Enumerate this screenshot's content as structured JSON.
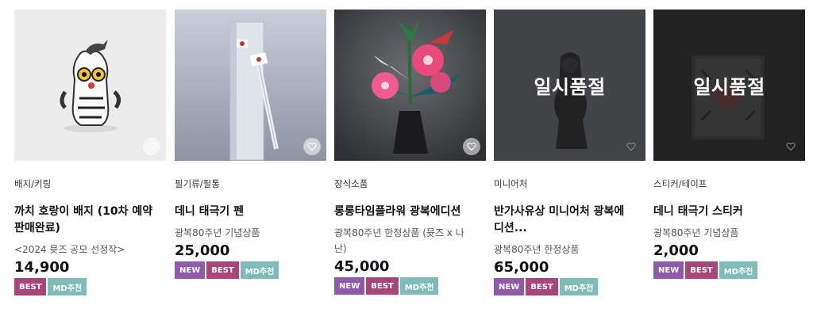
{
  "products": [
    {
      "category": "배지/키링",
      "name_lines": [
        "까치 호랑이 배지 (10차 예약",
        "판매완료)"
      ],
      "subtitle_lines": [
        "<2024 뮷즈 공모 선정작>"
      ],
      "price": "14,900",
      "badges": [
        "BEST",
        "MD추천"
      ],
      "sold_out": ""
    },
    {
      "category": "필기류/필통",
      "name_lines": [
        "데니 태극기 펜"
      ],
      "subtitle_lines": [
        "광복80주년 기념상품"
      ],
      "price": "25,000",
      "badges": [
        "NEW",
        "BEST",
        "MD추천"
      ],
      "sold_out": ""
    },
    {
      "category": "장식소품",
      "name_lines": [
        "롱롱타임플라워 광복에디션"
      ],
      "subtitle_lines": [
        "광복80주년 한정상품 (뮷즈 x 나",
        "난)"
      ],
      "price": "45,000",
      "badges": [
        "NEW",
        "BEST",
        "MD추천"
      ],
      "sold_out": ""
    },
    {
      "category": "미니어처",
      "name_lines": [
        "반가사유상 미니어처 광복에",
        "디션..."
      ],
      "subtitle_lines": [
        "광복80주년 한정상품"
      ],
      "price": "65,000",
      "badges": [
        "NEW",
        "BEST",
        "MD추천"
      ],
      "sold_out": "일시품절"
    },
    {
      "category": "스티커/테이프",
      "name_lines": [
        "데니 태극기 스티커"
      ],
      "subtitle_lines": [
        "광복80주년 기념상품"
      ],
      "price": "2,000",
      "badges": [
        "NEW",
        "BEST",
        "MD추천"
      ],
      "sold_out": "일시품절"
    }
  ],
  "icons": {
    "wishlist": "heart-outline-icon"
  },
  "colors": {
    "badge_new": "#8e5aa9",
    "badge_best": "#a8467c",
    "badge_md": "#7fbcb7"
  }
}
